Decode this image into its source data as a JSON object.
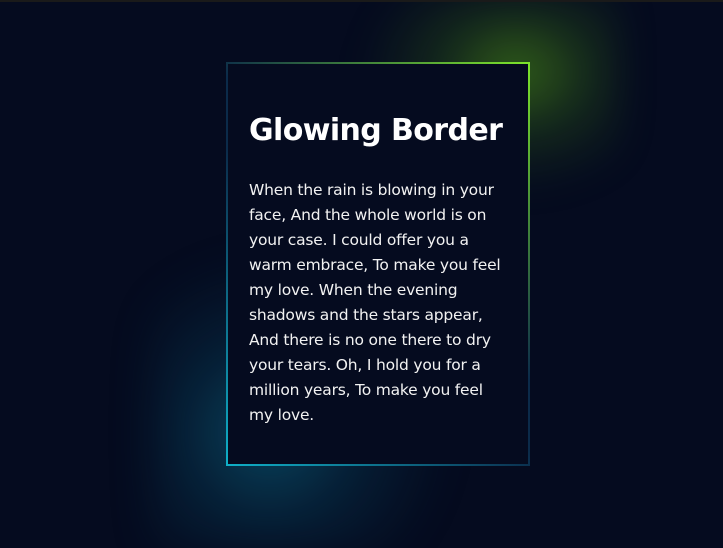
{
  "card": {
    "title": "Glowing Border",
    "paragraph": "When the rain is blowing in your face, And the whole world is on your case. I could offer you a warm embrace, To make you feel my love. When the evening shadows and the stars appear, And there is no one there to dry your tears. Oh, I hold you for a million years, To make you feel my love."
  },
  "colors": {
    "background": "#050b1f",
    "glow_top_right": "#7ee62a",
    "glow_bottom_left": "#0fb0c8",
    "title": "#ffffff",
    "text": "#f2f2f2"
  }
}
